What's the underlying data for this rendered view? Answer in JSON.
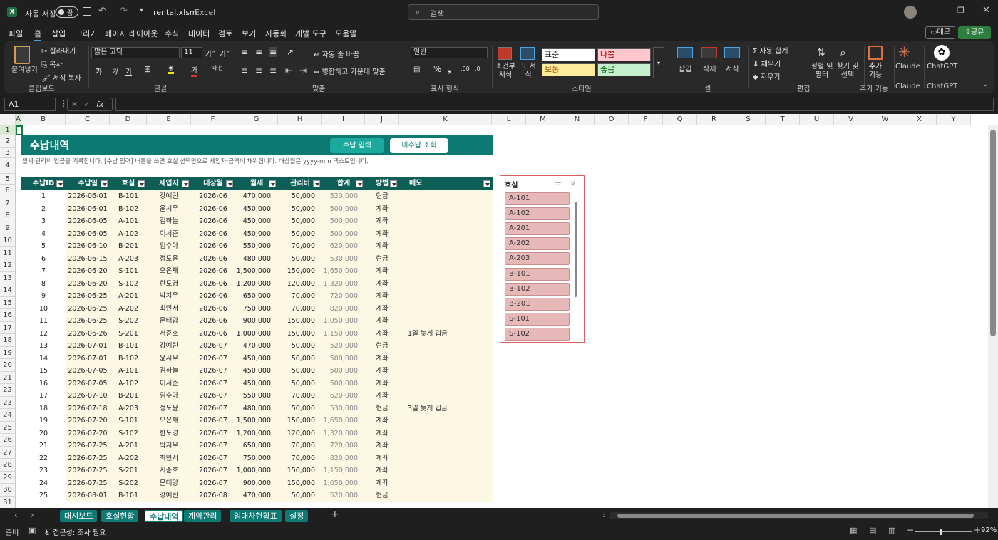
{
  "titlebar": {
    "autosave_label": "자동 저장",
    "autosave_state": "끔",
    "filename": "rental.xlsm",
    "app": "Excel",
    "search_placeholder": "검색"
  },
  "menu": {
    "items": [
      "파일",
      "홈",
      "삽입",
      "그리기",
      "페이지 레이아웃",
      "수식",
      "데이터",
      "검토",
      "보기",
      "자동화",
      "개발 도구",
      "도움말"
    ],
    "comment_btn": "메모",
    "share_btn": "공유"
  },
  "ribbon": {
    "clipboard": {
      "paste": "붙여넣기",
      "cut": "잘라내기",
      "copy": "복사",
      "format_painter": "서식 복사",
      "group": "클립보드"
    },
    "font": {
      "name": "맑은 고딕",
      "size": "11",
      "group": "글꼴"
    },
    "align": {
      "wrap": "자동 줄 바꿈",
      "merge": "병합하고 가운데 맞춤",
      "group": "맞춤"
    },
    "number": {
      "format": "일반",
      "group": "표시 형식"
    },
    "styles": {
      "cond": "조건부 서식",
      "table": "표 서식",
      "normal": "표준",
      "bad": "나쁨",
      "neutral": "보통",
      "good": "좋음",
      "group": "스타일"
    },
    "cells": {
      "insert": "삽입",
      "delete": "삭제",
      "format": "서식",
      "group": "셀"
    },
    "edit": {
      "autosum": "자동 합계",
      "fill": "채우기",
      "clear": "지우기",
      "sort": "정렬 및 필터",
      "find": "찾기 및 선택",
      "group": "편집"
    },
    "addins": {
      "label": "추가 기능",
      "group": "추가 기능"
    },
    "claude": {
      "label": "Claude",
      "group": "Claude"
    },
    "chatgpt": {
      "label": "ChatGPT",
      "group": "ChatGPT"
    }
  },
  "formula_bar": {
    "name_box": "A1",
    "formula": ""
  },
  "columns": [
    "A",
    "B",
    "C",
    "D",
    "E",
    "F",
    "G",
    "H",
    "I",
    "J",
    "K",
    "L",
    "M",
    "N",
    "O",
    "P",
    "Q",
    "R",
    "S",
    "T",
    "U",
    "V",
    "W",
    "X",
    "Y"
  ],
  "sheet": {
    "title": "수납내역",
    "btn_entry": "수납 입력",
    "btn_unpaid": "미수납 조회",
    "description": "월세·관리비 입금을 기록합니다. [수납 입력] 버튼을 쓰면 호실 선택만으로 세입자·금액이 채워집니다. 대상월은 yyyy-mm 텍스트입니다.",
    "headers": [
      "수납ID",
      "수납일",
      "호실",
      "세입자",
      "대상월",
      "월세",
      "관리비",
      "합계",
      "방법",
      "메모"
    ],
    "rows": [
      [
        "1",
        "2026-06-01",
        "B-101",
        "강예린",
        "2026-06",
        "470,000",
        "50,000",
        "520,000",
        "현금",
        ""
      ],
      [
        "2",
        "2026-06-01",
        "B-102",
        "윤시우",
        "2026-06",
        "450,000",
        "50,000",
        "500,000",
        "계좌",
        ""
      ],
      [
        "3",
        "2026-06-05",
        "A-101",
        "김하늘",
        "2026-06",
        "450,000",
        "50,000",
        "500,000",
        "계좌",
        ""
      ],
      [
        "4",
        "2026-06-05",
        "A-102",
        "이서준",
        "2026-06",
        "450,000",
        "50,000",
        "500,000",
        "계좌",
        ""
      ],
      [
        "5",
        "2026-06-10",
        "B-201",
        "임수아",
        "2026-06",
        "550,000",
        "70,000",
        "620,000",
        "계좌",
        ""
      ],
      [
        "6",
        "2026-06-15",
        "A-203",
        "정도윤",
        "2026-06",
        "480,000",
        "50,000",
        "530,000",
        "현금",
        ""
      ],
      [
        "7",
        "2026-06-20",
        "S-101",
        "오은채",
        "2026-06",
        "1,500,000",
        "150,000",
        "1,650,000",
        "계좌",
        ""
      ],
      [
        "8",
        "2026-06-20",
        "S-102",
        "한도경",
        "2026-06",
        "1,200,000",
        "120,000",
        "1,320,000",
        "계좌",
        ""
      ],
      [
        "9",
        "2026-06-25",
        "A-201",
        "박지우",
        "2026-06",
        "650,000",
        "70,000",
        "720,000",
        "계좌",
        ""
      ],
      [
        "10",
        "2026-06-25",
        "A-202",
        "최민서",
        "2026-06",
        "750,000",
        "70,000",
        "820,000",
        "계좌",
        ""
      ],
      [
        "11",
        "2026-06-25",
        "S-202",
        "문태양",
        "2026-06",
        "900,000",
        "150,000",
        "1,050,000",
        "계좌",
        ""
      ],
      [
        "12",
        "2026-06-26",
        "S-201",
        "서준호",
        "2026-06",
        "1,000,000",
        "150,000",
        "1,150,000",
        "계좌",
        "1일 늦게 입금"
      ],
      [
        "13",
        "2026-07-01",
        "B-101",
        "강예린",
        "2026-07",
        "470,000",
        "50,000",
        "520,000",
        "현금",
        ""
      ],
      [
        "14",
        "2026-07-01",
        "B-102",
        "윤시우",
        "2026-07",
        "450,000",
        "50,000",
        "500,000",
        "계좌",
        ""
      ],
      [
        "15",
        "2026-07-05",
        "A-101",
        "김하늘",
        "2026-07",
        "450,000",
        "50,000",
        "500,000",
        "계좌",
        ""
      ],
      [
        "16",
        "2026-07-05",
        "A-102",
        "이서준",
        "2026-07",
        "450,000",
        "50,000",
        "500,000",
        "계좌",
        ""
      ],
      [
        "17",
        "2026-07-10",
        "B-201",
        "임수아",
        "2026-07",
        "550,000",
        "70,000",
        "620,000",
        "계좌",
        ""
      ],
      [
        "18",
        "2026-07-18",
        "A-203",
        "정도윤",
        "2026-07",
        "480,000",
        "50,000",
        "530,000",
        "현금",
        "3일 늦게 입금"
      ],
      [
        "19",
        "2026-07-20",
        "S-101",
        "오은채",
        "2026-07",
        "1,500,000",
        "150,000",
        "1,650,000",
        "계좌",
        ""
      ],
      [
        "20",
        "2026-07-20",
        "S-102",
        "한도경",
        "2026-07",
        "1,200,000",
        "120,000",
        "1,320,000",
        "계좌",
        ""
      ],
      [
        "21",
        "2026-07-25",
        "A-201",
        "박지우",
        "2026-07",
        "650,000",
        "70,000",
        "720,000",
        "계좌",
        ""
      ],
      [
        "22",
        "2026-07-25",
        "A-202",
        "최민서",
        "2026-07",
        "750,000",
        "70,000",
        "820,000",
        "계좌",
        ""
      ],
      [
        "23",
        "2026-07-25",
        "S-201",
        "서준호",
        "2026-07",
        "1,000,000",
        "150,000",
        "1,150,000",
        "계좌",
        ""
      ],
      [
        "24",
        "2026-07-25",
        "S-202",
        "문태양",
        "2026-07",
        "900,000",
        "150,000",
        "1,050,000",
        "계좌",
        ""
      ],
      [
        "25",
        "2026-08-01",
        "B-101",
        "강예린",
        "2026-08",
        "470,000",
        "50,000",
        "520,000",
        "현금",
        ""
      ]
    ]
  },
  "slicer": {
    "title": "호실",
    "items": [
      "A-101",
      "A-102",
      "A-201",
      "A-202",
      "A-203",
      "B-101",
      "B-102",
      "B-201",
      "S-101",
      "S-102"
    ]
  },
  "tabs": [
    "대시보드",
    "호실현황",
    "수납내역",
    "계약관리",
    "임대차현황표",
    "설정"
  ],
  "active_tab": "수납내역",
  "status": {
    "ready": "준비",
    "accessibility": "접근성: 조사 필요",
    "zoom": "92%"
  }
}
